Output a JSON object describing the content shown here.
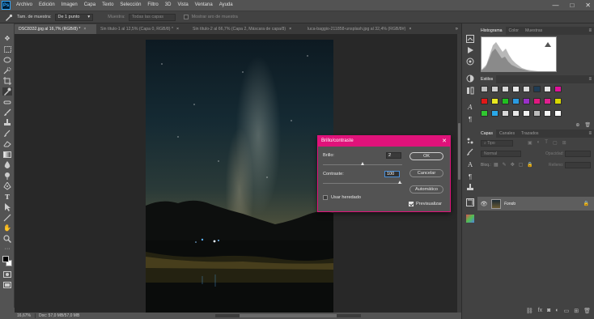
{
  "menubar": {
    "logo": "Ps",
    "items": [
      "Archivo",
      "Edición",
      "Imagen",
      "Capa",
      "Texto",
      "Selección",
      "Filtro",
      "3D",
      "Vista",
      "Ventana",
      "Ayuda"
    ],
    "win_controls": [
      "—",
      "□",
      "✕"
    ]
  },
  "options": {
    "sample_size_label": "Tam. de muestra:",
    "sample_size_value": "De 1 punto",
    "sample_label": "Muestra:",
    "sample_value": "Todas las capas",
    "show_ring_label": "Mostrar aro de muestra"
  },
  "tabs": [
    {
      "label": "DSC8332.jpg al 16,7% (RGB/8) *",
      "close": "×"
    },
    {
      "label": "Sin título-1 al 12,5% (Capa 0, RGB/8) *",
      "close": "×"
    },
    {
      "label": "Sin título-2 al 66,7% (Capa 2, Máscara de capa/8)",
      "close": "×"
    },
    {
      "label": "luca-baggio-211858-unsplash.jpg al 32,4% (RGB/8#)",
      "close": "×"
    }
  ],
  "tabs_more": "»",
  "status": {
    "zoom": "16,67%",
    "doc": "Doc: 57,0 MB/57,0 MB"
  },
  "histogram_panel": {
    "tabs": [
      "Histograma",
      "Color",
      "Muestras"
    ],
    "menu": "≡"
  },
  "styles_panel": {
    "tab": "Estilos",
    "menu": "≡",
    "row1": [
      "#bdbdbd",
      "#cfcfcf",
      "#d8d8d8",
      "#e8e8e8",
      "#dcdcdc",
      "#1f3c55",
      "#e6e6e6",
      "#e0129a"
    ],
    "row2": [
      "#e01818",
      "#e8e820",
      "#20c020",
      "#2a9ae0",
      "#9a30c8",
      "#e01880",
      "#e02090",
      "#d8d800"
    ],
    "row3": [
      "#30c830",
      "#2aa8e8",
      "#d8d8d8",
      "#e8e8e8",
      "#f2f2f2",
      "#bcbcbc",
      "#f4f4f4",
      "#ffffff"
    ]
  },
  "layers_panel": {
    "tabs": [
      "Capas",
      "Canales",
      "Trazados"
    ],
    "menu": "≡",
    "kind_filter": "Tipo",
    "blend_mode": "Normal",
    "opacity_label": "Opacidad:",
    "lock_label": "Bloq.:",
    "fill_label": "Relleno:",
    "layer_name": "Fondo"
  },
  "dialog": {
    "title": "Brillo/contraste",
    "close": "✕",
    "brightness_label": "Brillo:",
    "brightness_value": "2",
    "contrast_label": "Contraste:",
    "contrast_value": "100",
    "brightness_level": 2,
    "contrast_level": 100,
    "legacy_label": "Usar heredado",
    "legacy_checked": false,
    "preview_label": "Previsualizar",
    "preview_checked": true,
    "ok_label": "OK",
    "cancel_label": "Cancelar",
    "auto_label": "Automático"
  },
  "colors": {
    "accent": "#e0127a",
    "canvas_bg": "#282828",
    "panel_bg": "#424242"
  }
}
